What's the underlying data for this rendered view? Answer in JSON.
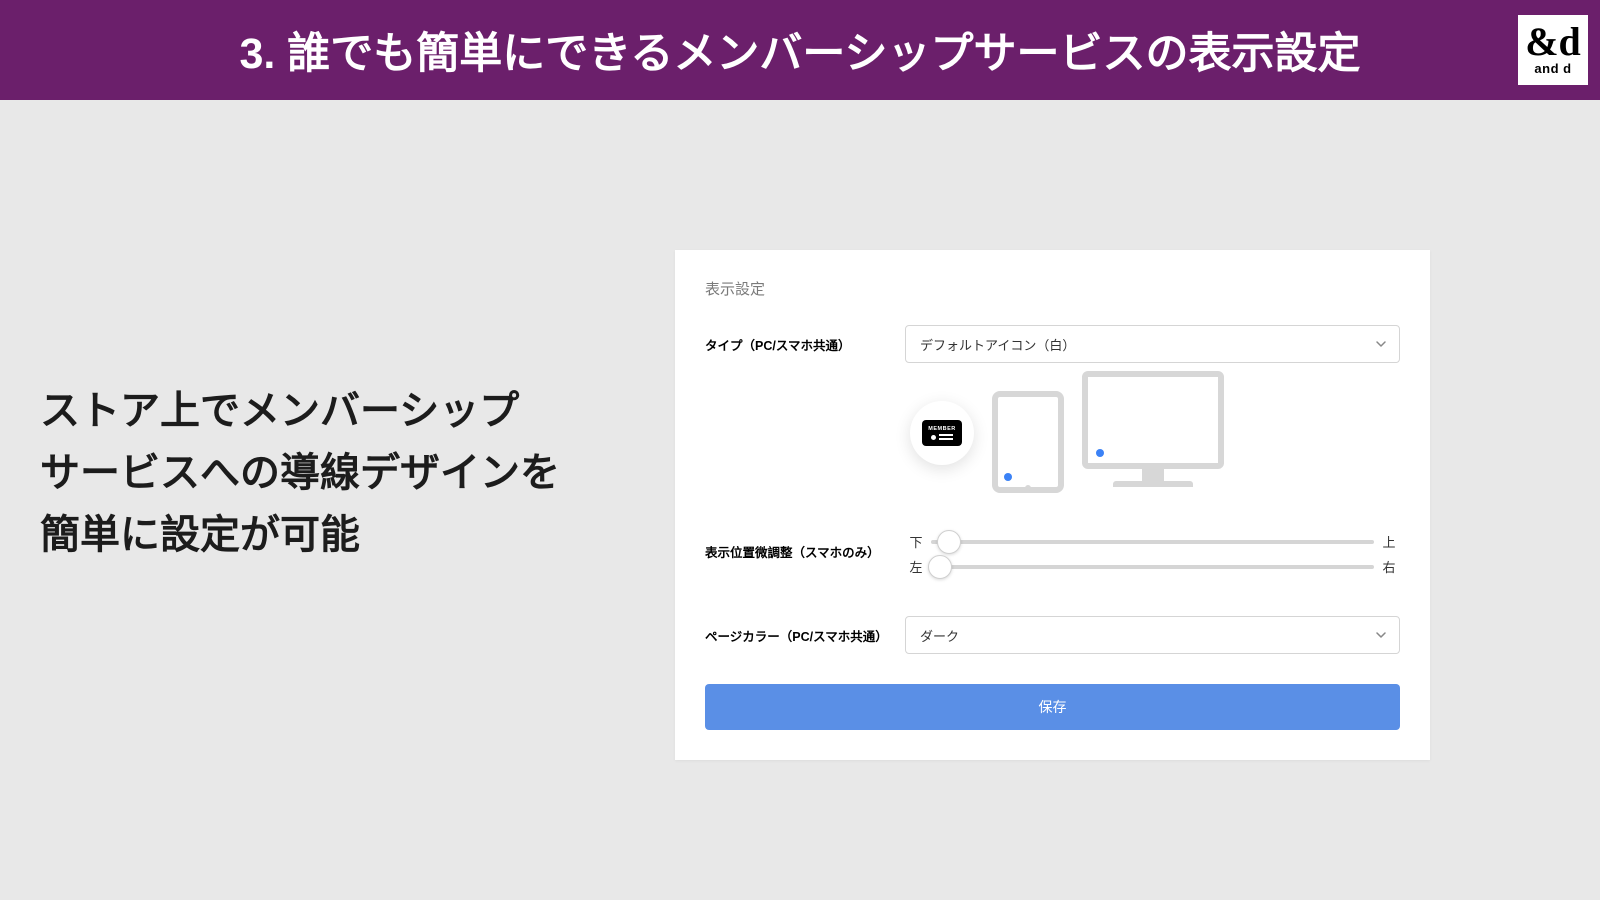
{
  "header": {
    "title": "3. 誰でも簡単にできるメンバーシップサービスの表示設定",
    "logo_mark": "&d",
    "logo_text": "and d"
  },
  "description": {
    "line1": "ストア上でメンバーシップ",
    "line2": "サービスへの導線デザインを",
    "line3": "簡単に設定が可能"
  },
  "panel": {
    "title": "表示設定",
    "type_label": "タイプ（PC/スマホ共通）",
    "type_value": "デフォルトアイコン（白）",
    "badge_text": "MEMBER",
    "position_label": "表示位置微調整（スマホのみ）",
    "slider1": {
      "start": "下",
      "end": "上",
      "pct": 4
    },
    "slider2": {
      "start": "左",
      "end": "右",
      "pct": 2
    },
    "color_label": "ページカラー（PC/スマホ共通）",
    "color_value": "ダーク",
    "save_label": "保存"
  }
}
